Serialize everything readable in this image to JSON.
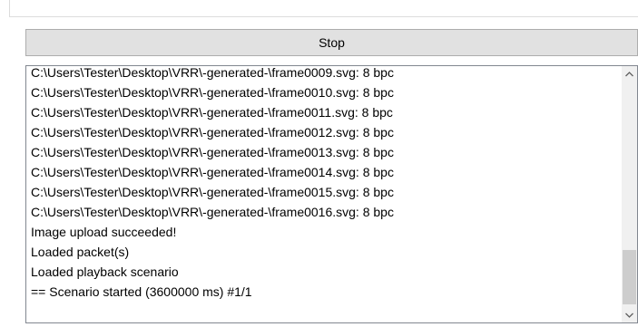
{
  "stop_button": {
    "label": "Stop"
  },
  "log": {
    "lines": [
      "C:\\Users\\Tester\\Desktop\\VRR\\-generated-\\frame0009.svg: 8 bpc",
      "C:\\Users\\Tester\\Desktop\\VRR\\-generated-\\frame0010.svg: 8 bpc",
      "C:\\Users\\Tester\\Desktop\\VRR\\-generated-\\frame0011.svg: 8 bpc",
      "C:\\Users\\Tester\\Desktop\\VRR\\-generated-\\frame0012.svg: 8 bpc",
      "C:\\Users\\Tester\\Desktop\\VRR\\-generated-\\frame0013.svg: 8 bpc",
      "C:\\Users\\Tester\\Desktop\\VRR\\-generated-\\frame0014.svg: 8 bpc",
      "C:\\Users\\Tester\\Desktop\\VRR\\-generated-\\frame0015.svg: 8 bpc",
      "C:\\Users\\Tester\\Desktop\\VRR\\-generated-\\frame0016.svg: 8 bpc",
      "Image upload succeeded!",
      "Loaded packet(s)",
      "Loaded playback scenario",
      "== Scenario started (3600000 ms) #1/1"
    ]
  },
  "scrollbar": {
    "up_icon": "chevron-up-icon",
    "down_icon": "chevron-down-icon"
  }
}
